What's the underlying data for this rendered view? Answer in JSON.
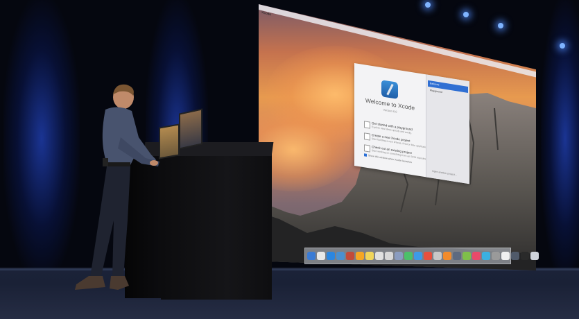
{
  "scene": {
    "description_tag": "keynote-stage"
  },
  "screen": {
    "menu_app": "Xcode",
    "dock_icon_count": 24
  },
  "xcode_welcome": {
    "title": "Welcome to Xcode",
    "version": "Version 6.0",
    "options": [
      {
        "title": "Get started with a playground",
        "subtitle": "Explore new ideas quickly and easily."
      },
      {
        "title": "Create a new Xcode project",
        "subtitle": "Start building a new iPhone, iPad or Mac application."
      },
      {
        "title": "Check out an existing project",
        "subtitle": "Start working on something from an SCM repository."
      }
    ],
    "checkbox_label": "Show this window when Xcode launches",
    "recent_projects": [
      "Balloons",
      "Playground"
    ],
    "open_other_label": "Open another project..."
  },
  "colors": {
    "stage_blue": "#1e3caa",
    "selection_blue": "#2f6fd3"
  }
}
